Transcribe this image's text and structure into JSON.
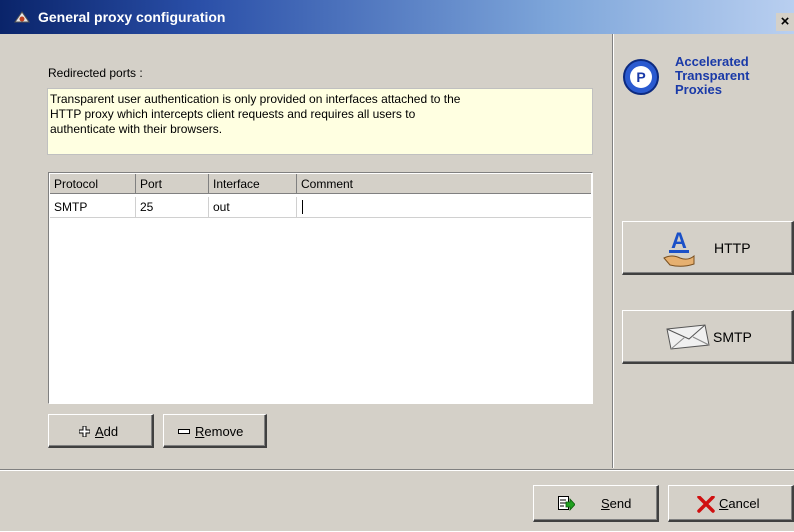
{
  "window": {
    "title": "General proxy configuration",
    "close_label": "×"
  },
  "main": {
    "ports_label": "Redirected ports :",
    "info_lines": [
      "Transparent user authentication is only provided on interfaces attached to the",
      "HTTP proxy which intercepts client requests and requires all users to",
      "authenticate with their browsers."
    ],
    "table": {
      "columns": [
        "Protocol",
        "Port",
        "Interface",
        "Comment"
      ],
      "rows": [
        {
          "protocol": "SMTP",
          "port": "25",
          "interface": "out",
          "comment": ""
        }
      ]
    },
    "add_button": {
      "mnemonic": "A",
      "rest": "dd"
    },
    "remove_button": {
      "mnemonic": "R",
      "rest": "emove"
    }
  },
  "sidebar": {
    "logo_lines": [
      "Accelerated",
      "Transparent",
      "Proxies"
    ],
    "http_button": "HTTP",
    "smtp_button": "SMTP"
  },
  "footer": {
    "send_button": {
      "mnemonic": "S",
      "rest": "end"
    },
    "cancel_button": {
      "mnemonic": "C",
      "rest": "ancel"
    }
  },
  "colors": {
    "title_start": "#0a246a",
    "title_end": "#b9cff0",
    "info_background": "#ffffe1",
    "dialog_face": "#d4d0c8"
  }
}
